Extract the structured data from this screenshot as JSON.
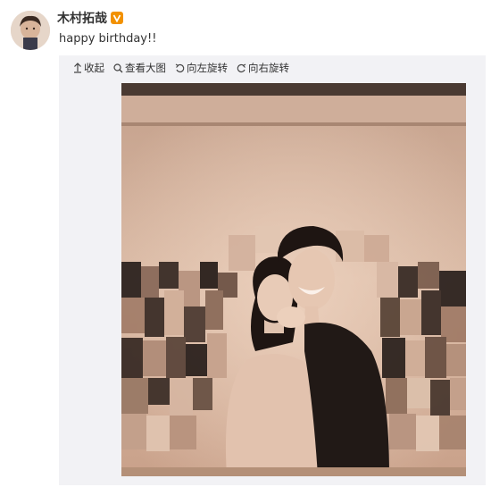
{
  "post": {
    "username": "木村拓哉",
    "text": "happy birthday!!"
  },
  "toolbar": {
    "collapse_label": "收起",
    "view_large_label": "查看大图",
    "rotate_left_label": "向左旋转",
    "rotate_right_label": "向右旋转"
  },
  "icons": {
    "verified": "verified-badge-icon",
    "collapse": "arrow-up-icon",
    "view_large": "magnifier-icon",
    "rotate_left": "rotate-left-icon",
    "rotate_right": "rotate-right-icon"
  },
  "colors": {
    "verified_badge": "#f29100",
    "panel_bg": "#f2f2f5",
    "photo_tone": "#c9a48e"
  }
}
